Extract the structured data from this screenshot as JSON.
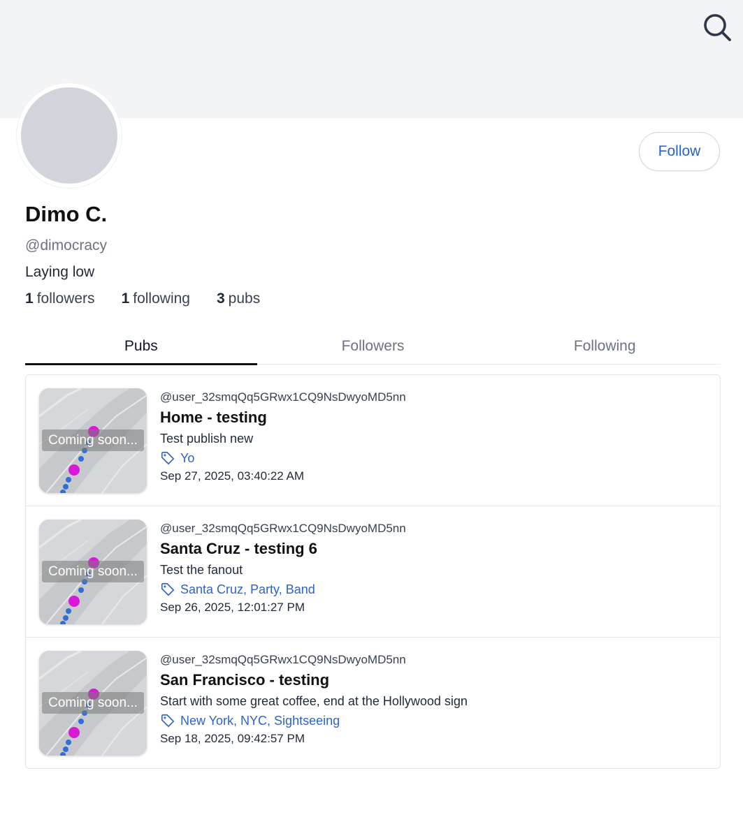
{
  "profile": {
    "name": "Dimo C.",
    "handle": "@dimocracy",
    "bio": "Laying low",
    "follow_label": "Follow",
    "stats": {
      "followers_count": "1",
      "followers_label": "followers",
      "following_count": "1",
      "following_label": "following",
      "pubs_count": "3",
      "pubs_label": "pubs"
    }
  },
  "header": {
    "search_icon": "search-icon"
  },
  "tabs": [
    {
      "label": "Pubs",
      "active": true
    },
    {
      "label": "Followers",
      "active": false
    },
    {
      "label": "Following",
      "active": false
    }
  ],
  "pubs": [
    {
      "thumbnail_text": "Coming soon...",
      "author": "@user_32smqQq5GRwx1CQ9NsDwyoMD5nn",
      "title": "Home - testing",
      "description": "Test publish new",
      "tags": "Yo",
      "date": "Sep 27, 2025, 03:40:22 AM"
    },
    {
      "thumbnail_text": "Coming soon...",
      "author": "@user_32smqQq5GRwx1CQ9NsDwyoMD5nn",
      "title": "Santa Cruz - testing 6",
      "description": "Test the fanout",
      "tags": "Santa Cruz, Party, Band",
      "date": "Sep 26, 2025, 12:01:27 PM"
    },
    {
      "thumbnail_text": "Coming soon...",
      "author": "@user_32smqQq5GRwx1CQ9NsDwyoMD5nn",
      "title": "San Francisco - testing",
      "description": "Start with some great coffee, end at the Hollywood sign",
      "tags": "New York, NYC, Sightseeing",
      "date": "Sep 18, 2025, 09:42:57 PM"
    }
  ],
  "colors": {
    "accent": "#2563c9",
    "banner": "#f3f4f6",
    "avatar": "#d1d5db",
    "route_start": "#d81ad8",
    "route_path": "#2f6fd8"
  }
}
